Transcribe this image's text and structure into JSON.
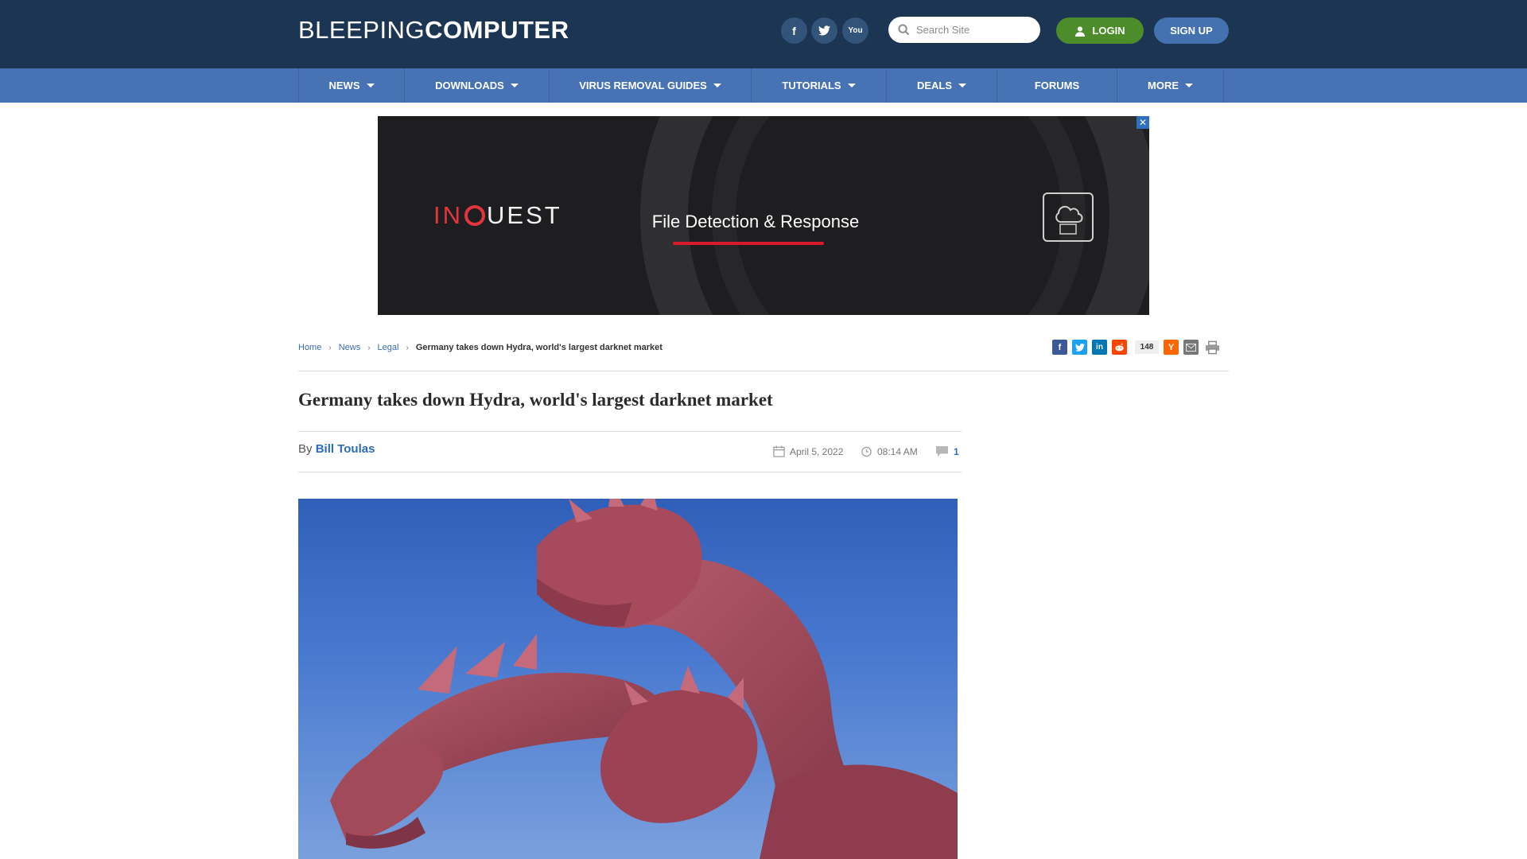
{
  "header": {
    "logo_light": "BLEEPING",
    "logo_bold": "COMPUTER",
    "social": {
      "facebook": "f",
      "twitter": "t",
      "youtube": "You"
    },
    "search_placeholder": "Search Site",
    "login_label": "LOGIN",
    "signup_label": "SIGN UP"
  },
  "nav": {
    "items": [
      {
        "label": "NEWS",
        "dropdown": true
      },
      {
        "label": "DOWNLOADS",
        "dropdown": true
      },
      {
        "label": "VIRUS REMOVAL GUIDES",
        "dropdown": true
      },
      {
        "label": "TUTORIALS",
        "dropdown": true
      },
      {
        "label": "DEALS",
        "dropdown": true
      },
      {
        "label": "FORUMS",
        "dropdown": false
      },
      {
        "label": "MORE",
        "dropdown": true
      }
    ]
  },
  "ad": {
    "brand_prefix": "IN",
    "brand_suffix": "UEST",
    "tagline": "File Detection & Response",
    "close_label": "✕"
  },
  "breadcrumb": {
    "items": [
      "Home",
      "News",
      "Legal"
    ],
    "current": "Germany takes down Hydra, world's largest darknet market"
  },
  "share": {
    "count": "148"
  },
  "article": {
    "title": "Germany takes down Hydra, world's largest darknet market",
    "by_label": "By",
    "author": "Bill Toulas",
    "date": "April 5, 2022",
    "time": "08:14 AM",
    "comments": "1"
  },
  "colors": {
    "header_bg": "#1c3553",
    "nav_bg": "#4773b5",
    "login_bg": "#4d8c2a",
    "signup_bg": "#4472b1",
    "link": "#2d6bb8"
  },
  "icons": [
    "search-icon",
    "user-icon",
    "calendar-icon",
    "clock-icon",
    "comment-icon",
    "email-icon",
    "print-icon"
  ]
}
